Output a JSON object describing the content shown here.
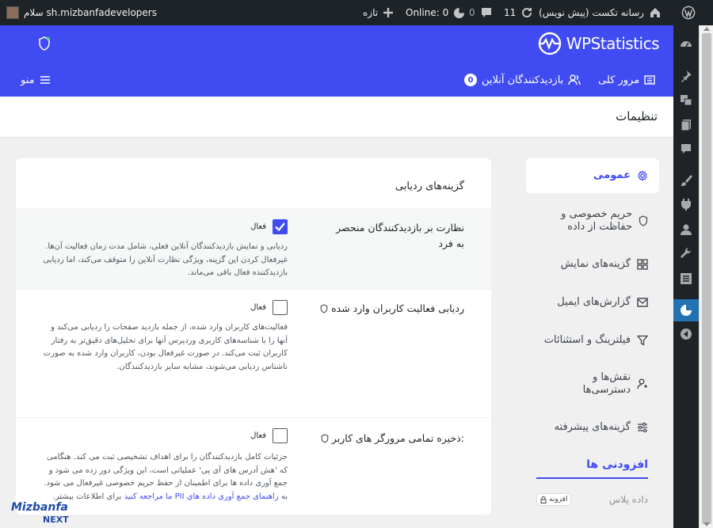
{
  "admin_bar": {
    "wp_logo": "wordpress-icon",
    "site_name": "رسانه تکست (پیش نویس)",
    "updates_count": "11",
    "comments_count": "0",
    "online_label": "Online: 0",
    "new_label": "تازه",
    "greeting": "سلام sh.mizbanfadevelopers"
  },
  "header": {
    "logo_text_light": "WP",
    "logo_text_bold": "Statistics",
    "nav_overview": "مرور کلی",
    "nav_online": "بازدیدکنندگان آنلاین",
    "online_count": "0",
    "menu_label": "منو"
  },
  "page": {
    "title": "تنظیمات"
  },
  "sidebar": {
    "items": [
      {
        "label": "عمومی",
        "icon": "gear-icon"
      },
      {
        "label": "حریم خصوصی و حفاظت از داده",
        "icon": "shield-icon"
      },
      {
        "label": "گزینه‌های نمایش",
        "icon": "grid-icon"
      },
      {
        "label": "گزارش‌های ایمیل",
        "icon": "mail-icon"
      },
      {
        "label": "فیلترینگ و استثنائات",
        "icon": "filter-icon"
      },
      {
        "label": "نقش‌ها و دسترسی‌ها",
        "icon": "user-roles-icon"
      },
      {
        "label": "گزینه‌های پیشرفته",
        "icon": "sliders-icon"
      }
    ],
    "addons_title": "افزودنی ها",
    "addon_name": "داده پلاس",
    "addon_badge": "افزونه"
  },
  "card": {
    "title": "گزینه‌های ردیابی",
    "rows": [
      {
        "label": "نظارت بر بازدیدکنندگان منحصر به فرد",
        "checkbox_label": "فعال",
        "checked": true,
        "description": "ردیابی و نمایش بازدیدکنندگان آنلاین فعلی، شامل مدت زمان فعالیت آن‌ها. غیرفعال کردن این گزینه، ویژگی نظارت آنلاین را متوقف می‌کند، اما ردیابی بازدیدکننده فعال باقی می‌ماند."
      },
      {
        "label": "ردیابی فعالیت کاربران وارد شده",
        "checkbox_label": "فعال",
        "checked": false,
        "description": "فعالیت‌های کاربران وارد شده، از جمله بازدید صفحات را ردیابی می‌کند و آنها را با شناسه‌های کاربری وردپرس آنها برای تحلیل‌های دقیق‌تر به رفتار کاربران ثبت می‌کند. در صورت غیرفعال بودن، کاربران وارد شده به صورت ناشناس ردیابی می‌شوند، مشابه سایر بازدیدکنندگان."
      },
      {
        "label": "ذخیره تمامی مرورگر های کاربر:",
        "checkbox_label": "فعال",
        "checked": false,
        "description": "جزئیات کامل بازدیدکنندگان را برای اهداف تشخیصی ثبت می کند. هنگامی که 'هش آدرس های آی پی' عملیاتی است، این ویژگی دور زده می شود و جمع آوری داده ها برای اطمینان از حفظ حریم خصوصی غیرفعال می شود. به",
        "link_text": "راهنمای جمع آوری داده های PII ما مراجعه کنید",
        "description_tail": "برای اطلاعات بیشتر."
      }
    ]
  },
  "watermark": {
    "line1": "Mizbanfa",
    "line2": "NEXT"
  },
  "colors": {
    "brand": "#404bf2",
    "admin_bar": "#1d2327",
    "active_menu": "#2271b1"
  }
}
